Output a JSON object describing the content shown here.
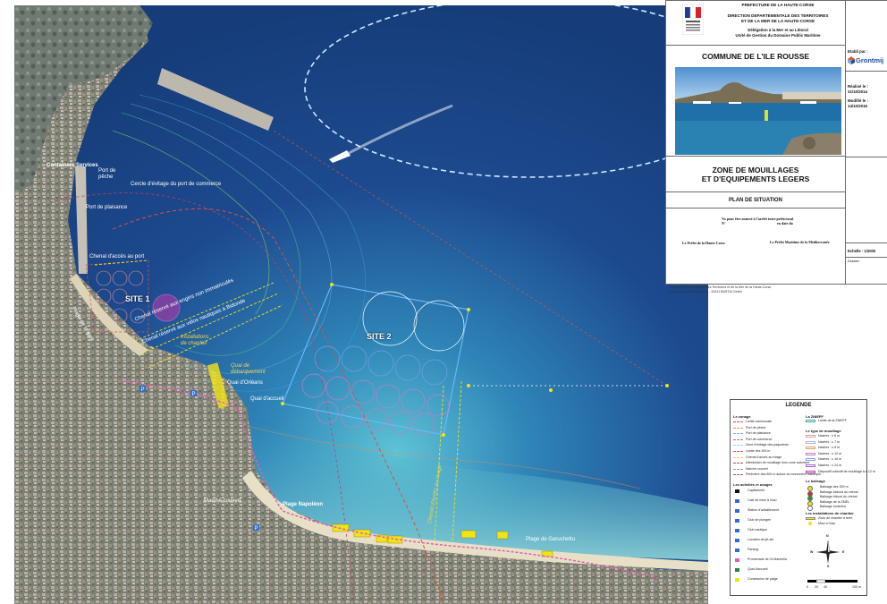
{
  "map": {
    "labels": {
      "containers_services": "Containers Services",
      "port_peche": "Port de pêche",
      "port_plaisance": "Port de plaisance",
      "cercle_evitage": "Cercle d'évitage du port de commerce",
      "chenal_port": "Chenal d'accès au port",
      "site1": "SITE 1",
      "site2": "SITE 2",
      "chenal_engins": "Chenal réservé aux engins non immatriculés",
      "chenal_velos": "Chenal réservé aux vélos nautiques à Bidonde",
      "installations_chantier": "Installations de chantier",
      "quai_debarquement": "Quai de débarquement",
      "quai_orleans": "Quai d'Orléans",
      "quai_accueil": "Quai d'accueil",
      "plage_gare": "Plage de la gare",
      "marche_couvert": "Marché couvert",
      "plage_napoleon": "Plage Napoléon",
      "chenal_rivage": "Chenal d'accès au rivage",
      "plage_garuchettu": "Plage de Garuchettu"
    },
    "colors": {
      "sea_deep": "#1d4a8f",
      "sea_shallow": "#3fa6c4",
      "land": "#8a8f84",
      "dashed_red": "#d9533b",
      "dashed_white": "#cfe9ff",
      "site_purple": "#b43aa8",
      "site_blue": "#6bbaff",
      "yellow": "#f2e318"
    }
  },
  "cartouche": {
    "header": {
      "prefecture": "PREFECTURE DE LA HAUTE-CORSE",
      "direction_1": "DIRECTION DEPARTEMENTALE DES TERRITOIRES",
      "direction_2": "ET DE LA MER DE LA HAUTE-CORSE",
      "delegation": "Délégation à la Mer et au Littoral",
      "unite": "Unité de Gestion du Domaine Public Maritime"
    },
    "commune": "COMMUNE DE L'ILE ROUSSE",
    "zone_title_1": "ZONE DE MOUILLAGES",
    "zone_title_2": "ET D'EQUIPEMENTS LEGERS",
    "plan": "PLAN DE SITUATION",
    "vu_1": "Vu pour être annexé à l'arrêté inter-préfectoral",
    "vu_2": "N°",
    "vu_3": "en date du",
    "signature_left": "Le Préfet de la Haute-Corse",
    "signature_right": "Le Préfet Maritime de la Méditerranée",
    "footer_1": "Direction Départementale des Territoires et de la Mer de la Haute-Corse",
    "footer_2": "8 boulevard Benoite Danesi - 20411 BASTIA Cedex"
  },
  "side_panel": {
    "etabli_par": "Etabli par :",
    "company": "Grontmij",
    "realise_le": "Réalisé le :",
    "realise_date": "31/10/2014",
    "modifie_le": "Modifié le :",
    "modifie_date": "14/10/2016",
    "echelle": "Echelle : 1/2000",
    "dossier": "Dossier"
  },
  "legend": {
    "title": "LEGENDE",
    "zonage_h": "Le zonage",
    "zonage": [
      {
        "label": "Limite communale",
        "color": "#d9533b"
      },
      {
        "label": "Port de pêche",
        "color": "#e39b3a"
      },
      {
        "label": "Port de plaisance",
        "color": "#7ab0e0"
      },
      {
        "label": "Port de commerce",
        "color": "#d06a6a"
      },
      {
        "label": "Zone d'évitage des paquebots",
        "color": "#8fd0ff"
      },
      {
        "label": "Limite des 300 m",
        "color": "#d9533b"
      },
      {
        "label": "Chenal d'accès au rivage",
        "color": "#e0d83a"
      },
      {
        "label": "Interdiction de mouillage hors zone autorisée",
        "color": "#c04060"
      },
      {
        "label": "Marché couvert",
        "color": "#999999"
      },
      {
        "label": "Périmètre des 500 m autour du monument historique",
        "color": "#b04090"
      }
    ],
    "activites_h": "Les activités et usages",
    "activites": [
      {
        "label": "Capitainerie",
        "icon": "building-icon"
      },
      {
        "label": "Cale de mise à l'eau",
        "icon": "ramp-icon"
      },
      {
        "label": "Station d'avitaillement",
        "icon": "fuel-icon"
      },
      {
        "label": "Club de plongée",
        "icon": "dive-icon"
      },
      {
        "label": "Club nautique",
        "icon": "boat-icon"
      },
      {
        "label": "Location de jet-ski",
        "icon": "jetski-icon"
      },
      {
        "label": "Parking",
        "icon": "parking-icon"
      },
      {
        "label": "Promenade de l'A Marinella",
        "icon": "walk-icon"
      },
      {
        "label": "Quai d'accueil",
        "icon": "quay-icon"
      },
      {
        "label": "Concession de plage",
        "icon": "beach-icon"
      }
    ],
    "znieff_h": "La ZNIEFF",
    "znieff": "Limite de la ZNIEFF",
    "mouillage_h": "Le type de mouillage",
    "mouillage": [
      {
        "label": "Navires : ≤ 6 m",
        "color": "#d9a0a0"
      },
      {
        "label": "Navires : ≤ 7 m",
        "color": "#b0b0d8"
      },
      {
        "label": "Navires : ≤ 8 m",
        "color": "#e0a060"
      },
      {
        "label": "Navires : ≤ 12 m",
        "color": "#c080c0"
      },
      {
        "label": "Navires : ≤ 16 m",
        "color": "#80a0e0"
      },
      {
        "label": "Navires : ≤ 24 m",
        "color": "#a060d0"
      },
      {
        "label": "Dispositif collectif de mouillage à ≤ 12 m",
        "color": "#b43aa8"
      }
    ],
    "balisage_h": "Le balisage",
    "balisage": [
      {
        "label": "Balisage des 300 m"
      },
      {
        "label": "Balisage bâbord du chenal"
      },
      {
        "label": "Balisage tribord du chenal"
      },
      {
        "label": "Balisage de la ZMEL"
      },
      {
        "label": "Balisage lumineux"
      }
    ],
    "chantier_h": "Les installations de chantier",
    "chantier": [
      {
        "label": "Zone de chantier à terre"
      },
      {
        "label": "Mise à l'eau"
      }
    ],
    "compass": {
      "n": "N",
      "s": "S",
      "e": "E",
      "w": "W"
    },
    "scale": {
      "t0": "0",
      "t1": "20",
      "t2": "40",
      "t3": "100 m"
    }
  }
}
